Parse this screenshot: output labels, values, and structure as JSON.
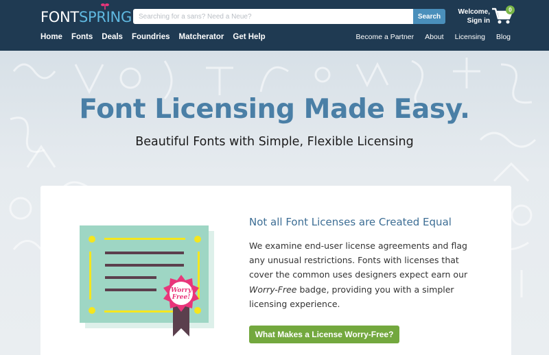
{
  "header": {
    "logo": {
      "part1": "FONT",
      "part2": "SPRING"
    },
    "search": {
      "placeholder": "Searching for a sans? Need a Neue?",
      "button_label": "Search"
    },
    "account": {
      "line1": "Welcome,",
      "line2": "Sign in"
    },
    "cart": {
      "count": "0",
      "icon": "cart-icon"
    },
    "nav_left": [
      "Home",
      "Fonts",
      "Deals",
      "Foundries",
      "Matcherator",
      "Get Help"
    ],
    "nav_right": [
      "Become a Partner",
      "About",
      "Licensing",
      "Blog"
    ]
  },
  "hero": {
    "title": "Font Licensing Made Easy.",
    "subtitle": "Beautiful Fonts with Simple, Flexible Licensing"
  },
  "card": {
    "heading": "Not all Font Licenses are Created Equal",
    "body_part1": "We examine end-user license agreements and flag any unusual restrictions. Fonts with licenses that cover the common uses designers expect earn our ",
    "body_emphasis": "Worry-Free",
    "body_part2": " badge, providing you with a simpler licensing experience.",
    "badge_text": [
      "Worry",
      "Free!"
    ],
    "cta_label": "What Makes a License Worry-Free?"
  },
  "colors": {
    "header_bg": "#1f3a52",
    "accent_blue": "#4a7fa6",
    "cta_green": "#73a83e",
    "certificate": "#9ed6c4",
    "badge_pink": "#e8357a"
  }
}
